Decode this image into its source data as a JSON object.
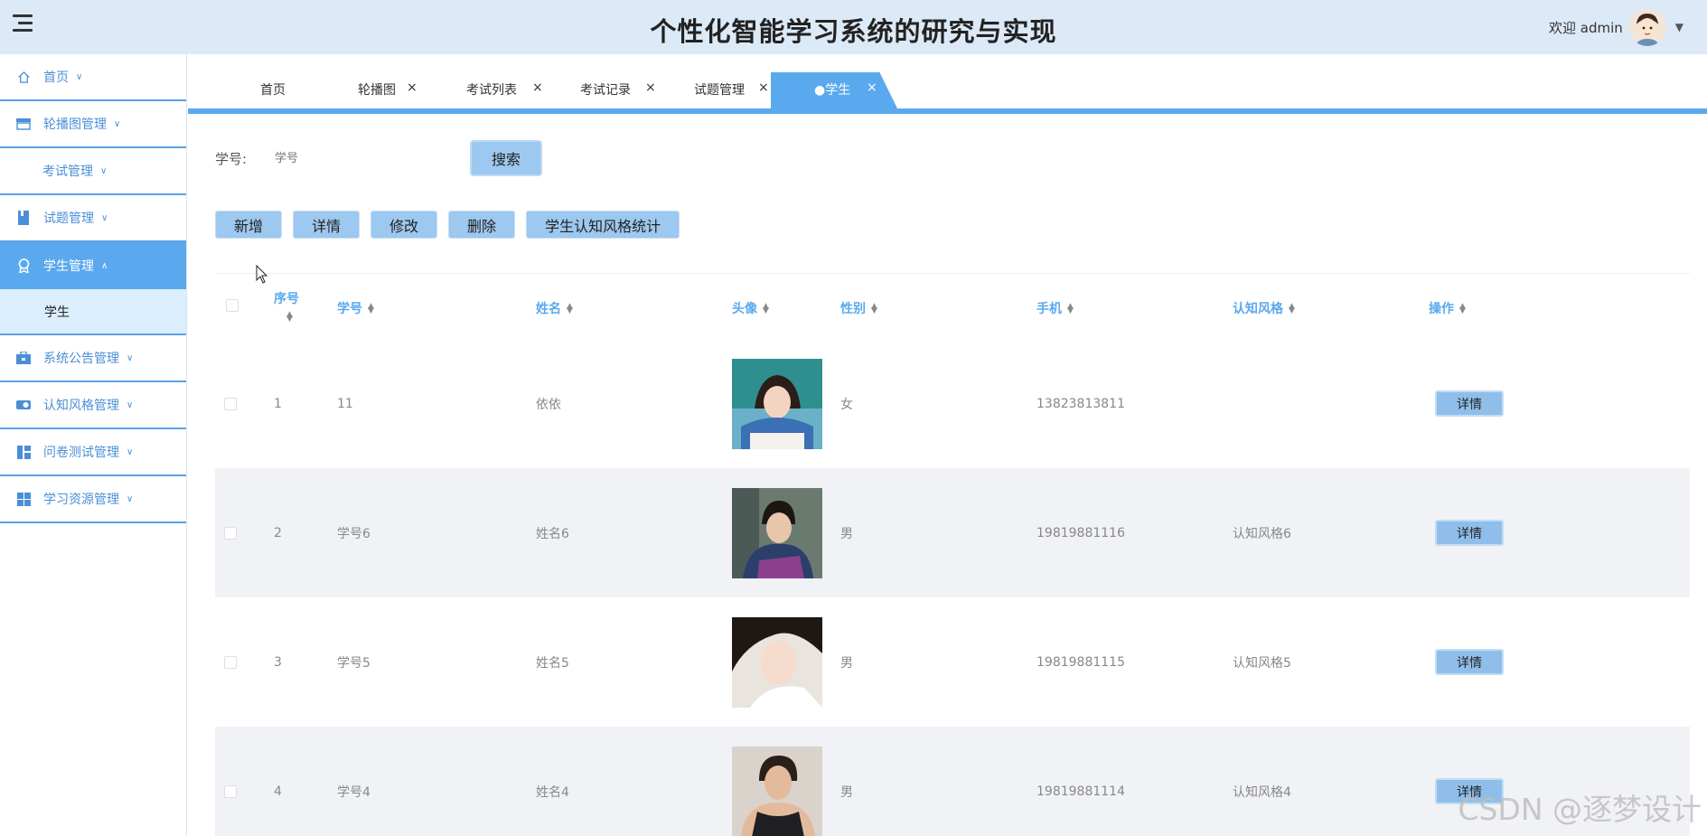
{
  "header": {
    "title": "个性化智能学习系统的研究与实现",
    "welcome": "欢迎 admin",
    "menu_icon": "hamburger-icon"
  },
  "sidebar": {
    "items": [
      {
        "label": "首页",
        "icon": "home-icon"
      },
      {
        "label": "轮播图管理",
        "icon": "carousel-icon"
      },
      {
        "label": "考试管理",
        "icon": ""
      },
      {
        "label": "试题管理",
        "icon": "book-icon"
      },
      {
        "label": "学生管理",
        "icon": "student-icon",
        "active": true
      },
      {
        "label": "学生",
        "submenu": true
      },
      {
        "label": "系统公告管理",
        "icon": "briefcase-icon"
      },
      {
        "label": "认知风格管理",
        "icon": "switch-icon"
      },
      {
        "label": "问卷测试管理",
        "icon": "grid-icon"
      },
      {
        "label": "学习资源管理",
        "icon": "windows-icon"
      }
    ]
  },
  "tabs": [
    {
      "label": "首页",
      "closable": false
    },
    {
      "label": "轮播图",
      "closable": true
    },
    {
      "label": "考试列表",
      "closable": true
    },
    {
      "label": "考试记录",
      "closable": true
    },
    {
      "label": "试题管理",
      "closable": true
    },
    {
      "label": "●学生",
      "closable": true,
      "active": true
    }
  ],
  "search": {
    "label": "学号:",
    "placeholder": "学号",
    "button": "搜索"
  },
  "actions": [
    "新增",
    "详情",
    "修改",
    "删除",
    "学生认知风格统计"
  ],
  "table": {
    "columns": [
      "序号",
      "学号",
      "姓名",
      "头像",
      "性别",
      "手机",
      "认知风格",
      "操作"
    ],
    "rows": [
      {
        "index": "1",
        "student_id": "11",
        "name": "依依",
        "gender": "女",
        "phone": "13823813811",
        "style": "",
        "action": "详情"
      },
      {
        "index": "2",
        "student_id": "学号6",
        "name": "姓名6",
        "gender": "男",
        "phone": "19819881116",
        "style": "认知风格6",
        "action": "详情"
      },
      {
        "index": "3",
        "student_id": "学号5",
        "name": "姓名5",
        "gender": "男",
        "phone": "19819881115",
        "style": "认知风格5",
        "action": "详情"
      },
      {
        "index": "4",
        "student_id": "学号4",
        "name": "姓名4",
        "gender": "男",
        "phone": "19819881114",
        "style": "认知风格4",
        "action": "详情"
      }
    ]
  },
  "watermark": "CSDN @逐梦设计",
  "colors": {
    "header_bg": "#dce9f7",
    "accent": "#5aa9ee",
    "button_bg": "#9dc8ef",
    "stripe": "#f0f2f5"
  }
}
